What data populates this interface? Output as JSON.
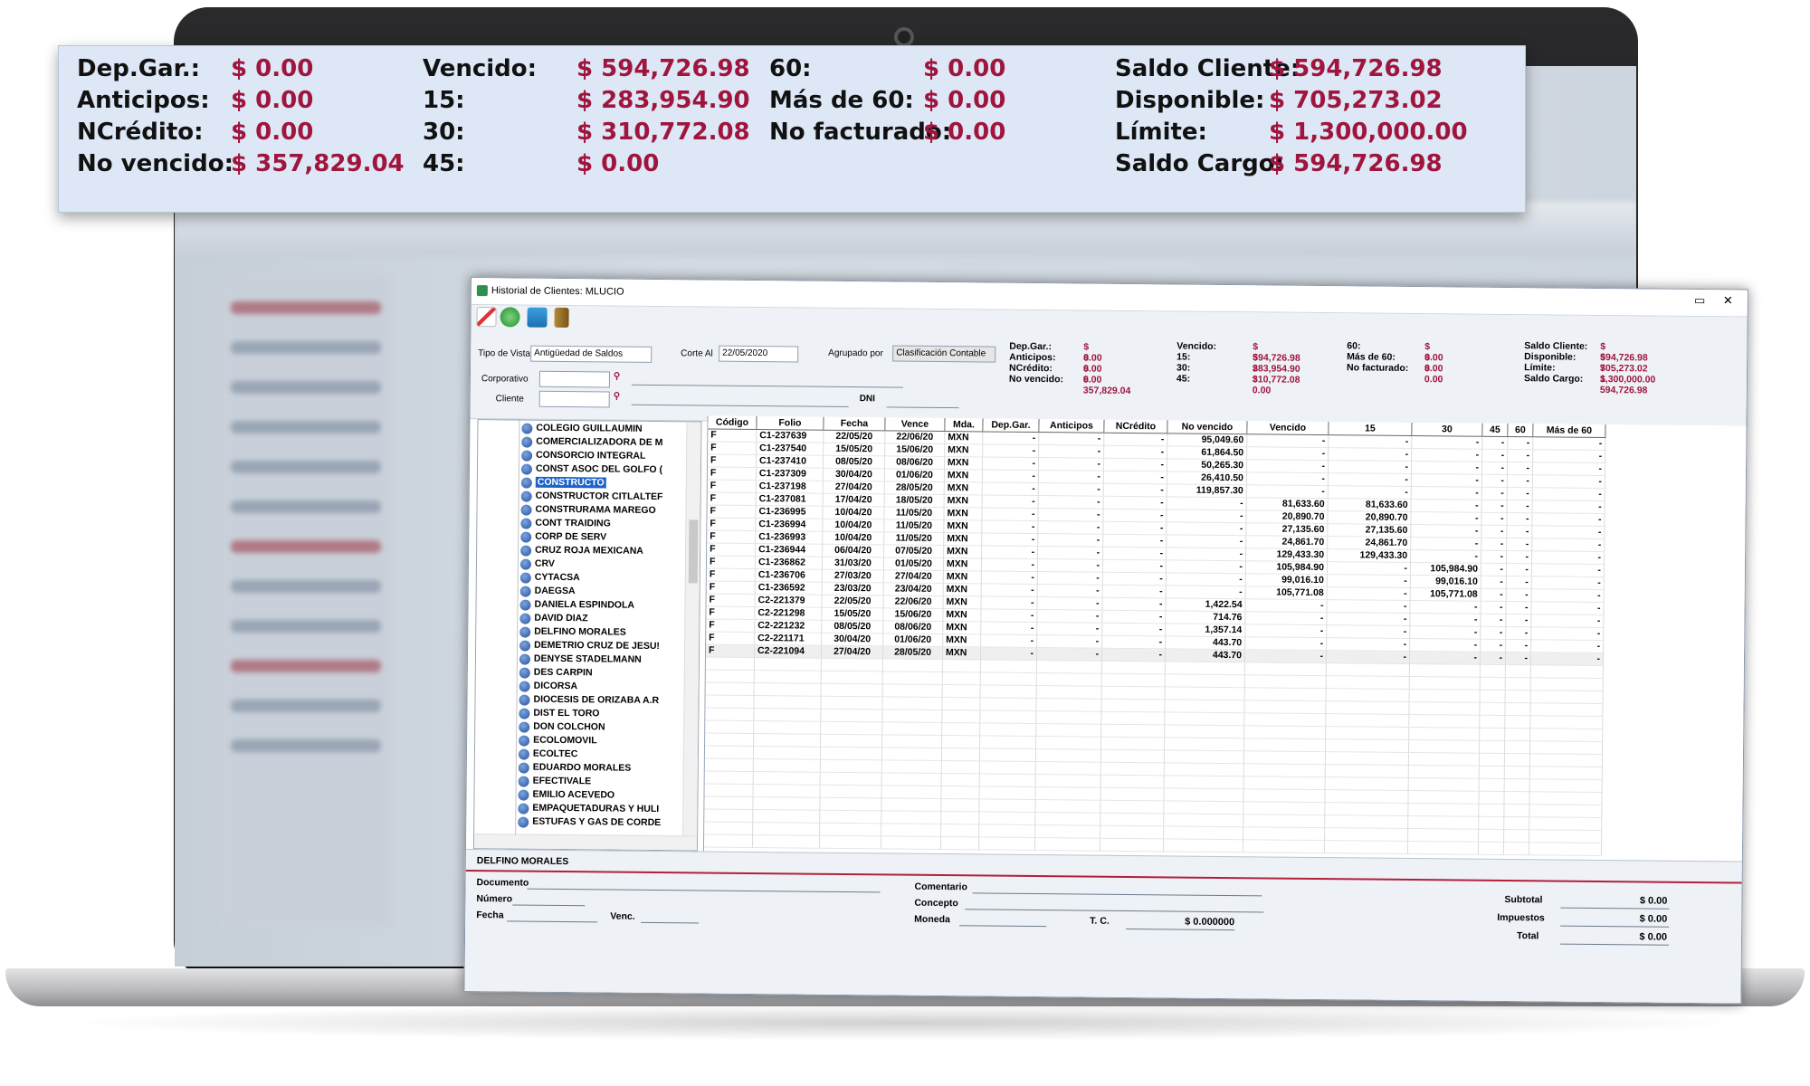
{
  "summary": {
    "dep_gar_label": "Dep.Gar.:",
    "dep_gar": "$ 0.00",
    "anticipos_label": "Anticipos:",
    "anticipos": "$ 0.00",
    "ncredito_label": "NCrédito:",
    "ncredito": "$ 0.00",
    "no_vencido_label": "No vencido:",
    "no_vencido": "$ 357,829.04",
    "vencido_label": "Vencido:",
    "vencido": "$ 594,726.98",
    "d15_label": "15:",
    "d15": "$ 283,954.90",
    "d30_label": "30:",
    "d30": "$ 310,772.08",
    "d45_label": "45:",
    "d45": "$ 0.00",
    "d60_label": "60:",
    "d60": "$ 0.00",
    "mas60_label": "Más de  60:",
    "mas60": "$ 0.00",
    "no_facturado_label": "No facturado:",
    "no_facturado": "$ 0.00",
    "saldo_cliente_label": "Saldo Cliente:",
    "saldo_cliente": "$ 594,726.98",
    "disponible_label": "Disponible:",
    "disponible": "$ 705,273.02",
    "limite_label": "Límite:",
    "limite": "$ 1,300,000.00",
    "saldo_cargo_label": "Saldo Cargo:",
    "saldo_cargo": "$ 594,726.98"
  },
  "window": {
    "title": "Historial de Clientes: MLUCIO",
    "controls": "▭ ✕"
  },
  "filters": {
    "tipo_vista_label": "Tipo de Vista",
    "tipo_vista_value": "Antigüedad de Saldos",
    "corte_label": "Corte Al",
    "corte_value": "22/05/2020",
    "agrupado_label": "Agrupado por",
    "agrupado_value": "Clasificación Contable",
    "corporativo_label": "Corporativo",
    "cliente_label": "Cliente",
    "dni_label": "DNI"
  },
  "tree": {
    "items": [
      "COLEGIO GUILLAUMIN",
      "COMERCIALIZADORA DE M",
      "CONSORCIO INTEGRAL",
      "CONST ASOC DEL GOLFO (",
      "CONSTRUCTO",
      "CONSTRUCTOR CITLALTEF",
      "CONSTRURAMA MAREGO",
      "CONT TRAIDING",
      "CORP DE SERV",
      "CRUZ ROJA MEXICANA",
      "CRV",
      "CYTACSA",
      "DAEGSA",
      "DANIELA ESPINDOLA",
      "DAVID DIAZ",
      "DELFINO MORALES",
      "DEMETRIO CRUZ DE JESU!",
      "DENYSE STADELMANN",
      "DES CARPIN",
      "DICORSA",
      "DIOCESIS DE ORIZABA A.R",
      "DIST EL TORO",
      "DON COLCHON",
      "ECOLOMOVIL",
      "ECOLTEC",
      "EDUARDO MORALES",
      "EFECTIVALE",
      "EMILIO ACEVEDO",
      "EMPAQUETADURAS Y HULI",
      "ESTUFAS Y GAS DE CORDE"
    ],
    "selected_index": 4
  },
  "grid": {
    "headers": [
      "Código",
      "Folio",
      "Fecha",
      "Vence",
      "Mda.",
      "Dep.Gar.",
      "Anticipos",
      "NCrédito",
      "No vencido",
      "Vencido",
      "15",
      "30",
      "45",
      "60",
      "Más de  60"
    ],
    "rows": [
      [
        "F",
        "C1-237639",
        "22/05/20",
        "22/06/20",
        "MXN",
        "-",
        "-",
        "-",
        "95,049.60",
        "-",
        "-",
        "-",
        "-",
        "-",
        "-"
      ],
      [
        "F",
        "C1-237540",
        "15/05/20",
        "15/06/20",
        "MXN",
        "-",
        "-",
        "-",
        "61,864.50",
        "-",
        "-",
        "-",
        "-",
        "-",
        "-"
      ],
      [
        "F",
        "C1-237410",
        "08/05/20",
        "08/06/20",
        "MXN",
        "-",
        "-",
        "-",
        "50,265.30",
        "-",
        "-",
        "-",
        "-",
        "-",
        "-"
      ],
      [
        "F",
        "C1-237309",
        "30/04/20",
        "01/06/20",
        "MXN",
        "-",
        "-",
        "-",
        "26,410.50",
        "-",
        "-",
        "-",
        "-",
        "-",
        "-"
      ],
      [
        "F",
        "C1-237198",
        "27/04/20",
        "28/05/20",
        "MXN",
        "-",
        "-",
        "-",
        "119,857.30",
        "-",
        "-",
        "-",
        "-",
        "-",
        "-"
      ],
      [
        "F",
        "C1-237081",
        "17/04/20",
        "18/05/20",
        "MXN",
        "-",
        "-",
        "-",
        "-",
        "81,633.60",
        "81,633.60",
        "-",
        "-",
        "-",
        "-"
      ],
      [
        "F",
        "C1-236995",
        "10/04/20",
        "11/05/20",
        "MXN",
        "-",
        "-",
        "-",
        "-",
        "20,890.70",
        "20,890.70",
        "-",
        "-",
        "-",
        "-"
      ],
      [
        "F",
        "C1-236994",
        "10/04/20",
        "11/05/20",
        "MXN",
        "-",
        "-",
        "-",
        "-",
        "27,135.60",
        "27,135.60",
        "-",
        "-",
        "-",
        "-"
      ],
      [
        "F",
        "C1-236993",
        "10/04/20",
        "11/05/20",
        "MXN",
        "-",
        "-",
        "-",
        "-",
        "24,861.70",
        "24,861.70",
        "-",
        "-",
        "-",
        "-"
      ],
      [
        "F",
        "C1-236944",
        "06/04/20",
        "07/05/20",
        "MXN",
        "-",
        "-",
        "-",
        "-",
        "129,433.30",
        "129,433.30",
        "-",
        "-",
        "-",
        "-"
      ],
      [
        "F",
        "C1-236862",
        "31/03/20",
        "01/05/20",
        "MXN",
        "-",
        "-",
        "-",
        "-",
        "105,984.90",
        "-",
        "105,984.90",
        "-",
        "-",
        "-"
      ],
      [
        "F",
        "C1-236706",
        "27/03/20",
        "27/04/20",
        "MXN",
        "-",
        "-",
        "-",
        "-",
        "99,016.10",
        "-",
        "99,016.10",
        "-",
        "-",
        "-"
      ],
      [
        "F",
        "C1-236592",
        "23/03/20",
        "23/04/20",
        "MXN",
        "-",
        "-",
        "-",
        "-",
        "105,771.08",
        "-",
        "105,771.08",
        "-",
        "-",
        "-"
      ],
      [
        "F",
        "C2-221379",
        "22/05/20",
        "22/06/20",
        "MXN",
        "-",
        "-",
        "-",
        "1,422.54",
        "-",
        "-",
        "-",
        "-",
        "-",
        "-"
      ],
      [
        "F",
        "C2-221298",
        "15/05/20",
        "15/06/20",
        "MXN",
        "-",
        "-",
        "-",
        "714.76",
        "-",
        "-",
        "-",
        "-",
        "-",
        "-"
      ],
      [
        "F",
        "C2-221232",
        "08/05/20",
        "08/06/20",
        "MXN",
        "-",
        "-",
        "-",
        "1,357.14",
        "-",
        "-",
        "-",
        "-",
        "-",
        "-"
      ],
      [
        "F",
        "C2-221171",
        "30/04/20",
        "01/06/20",
        "MXN",
        "-",
        "-",
        "-",
        "443.70",
        "-",
        "-",
        "-",
        "-",
        "-",
        "-"
      ],
      [
        "F",
        "C2-221094",
        "27/04/20",
        "28/05/20",
        "MXN",
        "-",
        "-",
        "-",
        "443.70",
        "-",
        "-",
        "-",
        "-",
        "-",
        "-"
      ]
    ]
  },
  "detail": {
    "client_name": "DELFINO MORALES",
    "documento_label": "Documento",
    "numero_label": "Número",
    "fecha_label": "Fecha",
    "venc_label": "Venc.",
    "comentario_label": "Comentario",
    "concepto_label": "Concepto",
    "moneda_label": "Moneda",
    "tc_label": "T. C.",
    "tc_value": "$ 0.000000",
    "subtotal_label": "Subtotal",
    "subtotal": "$ 0.00",
    "impuestos_label": "Impuestos",
    "impuestos": "$ 0.00",
    "total_label": "Total",
    "total": "$ 0.00"
  },
  "colors": {
    "accent_value": "#a0153e",
    "selection": "#1e63c9"
  }
}
